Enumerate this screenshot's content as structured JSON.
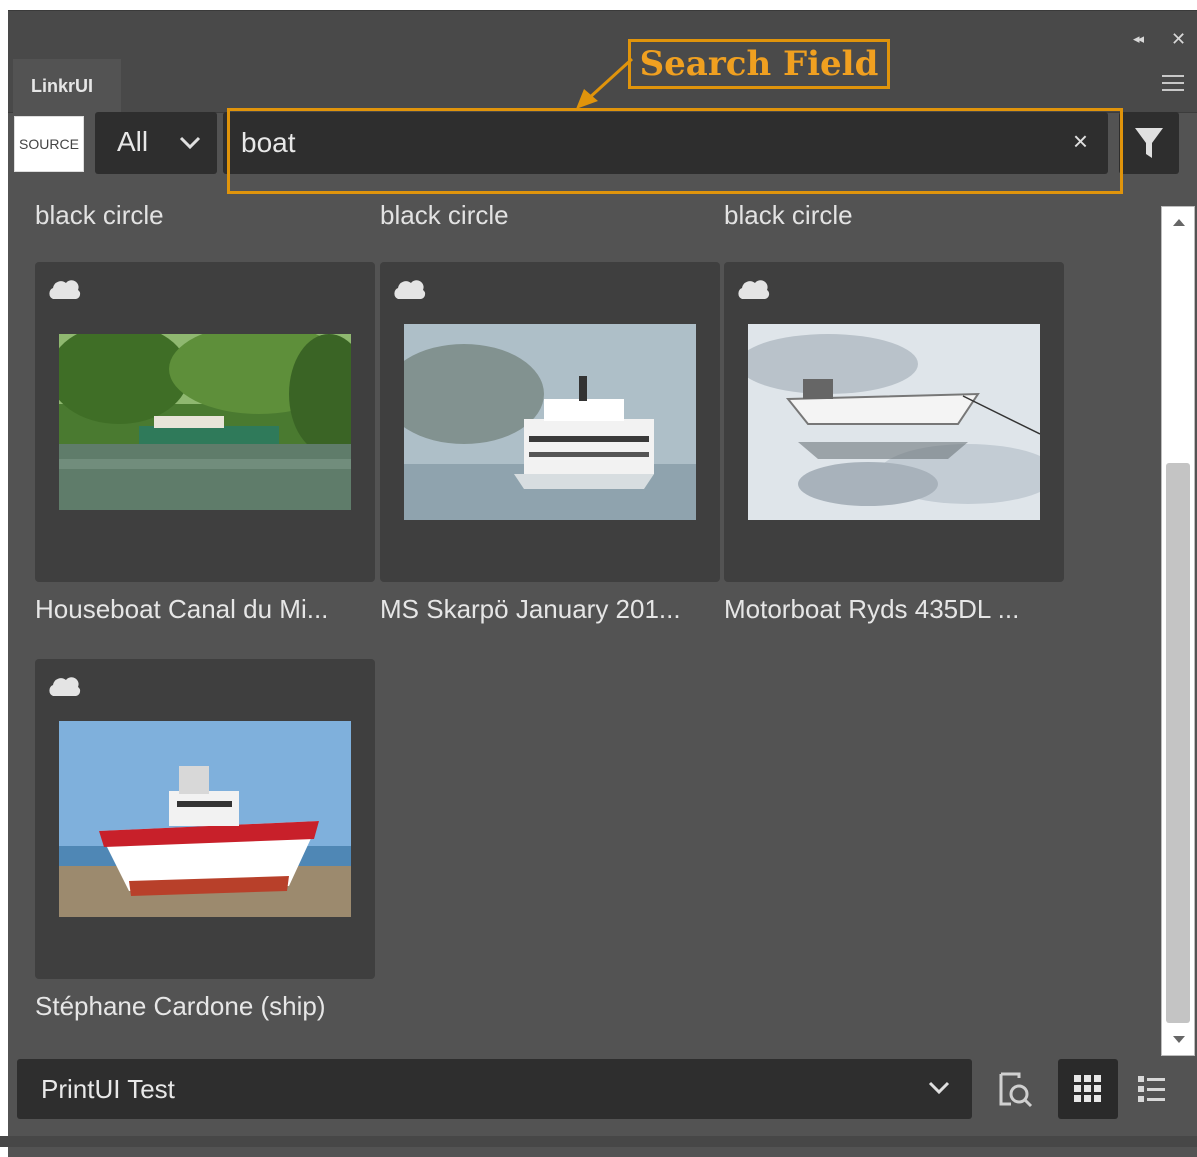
{
  "panel": {
    "tab_label": "LinkrUI",
    "collapse_glyph": "◂◂",
    "close_glyph": "✕"
  },
  "annotation": {
    "label": "Search Field",
    "color": "#e0940b"
  },
  "toolbar": {
    "source_label": "SOURCE",
    "scope_value": "All",
    "search_value": "boat",
    "clear_glyph": "×"
  },
  "results": {
    "top_labels": [
      "black circle",
      "black circle",
      "black circle"
    ],
    "items": [
      {
        "caption": "Houseboat Canal du Mi..."
      },
      {
        "caption": "MS Skarpö January 201..."
      },
      {
        "caption": "Motorboat Ryds 435DL ..."
      },
      {
        "caption": "Stéphane Cardone (ship)"
      }
    ]
  },
  "footer": {
    "selected_collection": "PrintUI Test"
  },
  "colors": {
    "panel_bg": "#535353",
    "field_bg": "#2e2e2e",
    "card_bg": "#3f3f3f",
    "text": "#e6e6e6",
    "accent": "#e0940b"
  }
}
